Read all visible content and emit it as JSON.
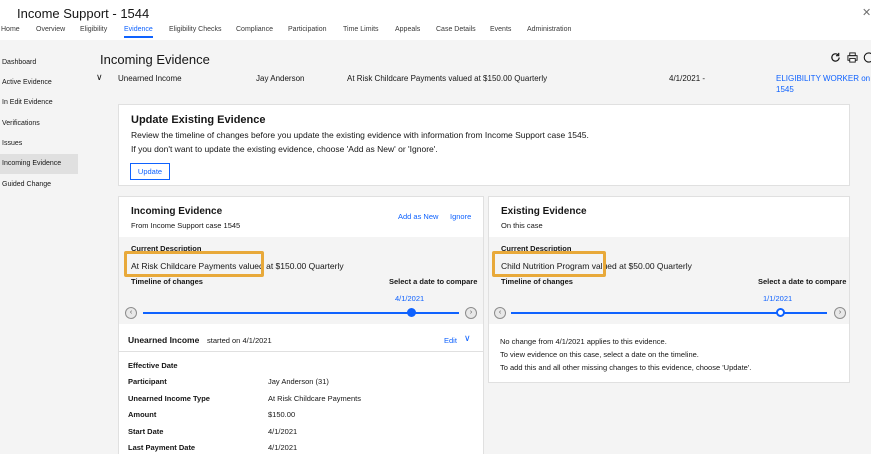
{
  "header": {
    "title": "Income Support - 1544",
    "close_glyph": "✕"
  },
  "tabs": [
    {
      "label": "Home"
    },
    {
      "label": "Overview"
    },
    {
      "label": "Eligibility"
    },
    {
      "label": "Evidence"
    },
    {
      "label": "Eligibility Checks"
    },
    {
      "label": "Compliance"
    },
    {
      "label": "Participation"
    },
    {
      "label": "Time Limits"
    },
    {
      "label": "Appeals"
    },
    {
      "label": "Case Details"
    },
    {
      "label": "Events"
    },
    {
      "label": "Administration"
    }
  ],
  "active_tab": "Evidence",
  "sidebar": {
    "items": [
      {
        "label": "Dashboard"
      },
      {
        "label": "Active Evidence"
      },
      {
        "label": "In Edit Evidence"
      },
      {
        "label": "Verifications"
      },
      {
        "label": "Issues"
      },
      {
        "label": "Incoming Evidence"
      },
      {
        "label": "Guided Change"
      }
    ],
    "active": "Incoming Evidence"
  },
  "page": {
    "title": "Incoming Evidence",
    "icons": [
      "refresh-icon",
      "print-icon",
      "help-icon"
    ]
  },
  "evidence_row": {
    "chevron": "∨",
    "type": "Unearned Income",
    "participant": "Jay Anderson",
    "description": "At Risk Childcare Payments valued at $150.00 Quarterly",
    "period": "4/1/2021 -",
    "owner_line1": "ELIGIBILITY WORKER on",
    "owner_line2": "1545"
  },
  "update_panel": {
    "title": "Update Existing Evidence",
    "line1": "Review the timeline of changes before you update the existing evidence with information from Income Support case 1545.",
    "line2": "If you don't want to update the existing evidence, choose 'Add as New' or 'Ignore'.",
    "button": "Update"
  },
  "incoming": {
    "title": "Incoming Evidence",
    "subtitle": "From Income Support case 1545",
    "add_as_new": "Add as New",
    "ignore": "Ignore",
    "current_description_label": "Current Description",
    "current_description": "At Risk Childcare Payments valued at $150.00 Quarterly",
    "timeline_label": "Timeline of changes",
    "compare_label": "Select a date to compare",
    "selected_date": "4/1/2021",
    "section_title": "Unearned Income",
    "section_started": "started on 4/1/2021",
    "edit": "Edit",
    "details": [
      {
        "label": "Effective Date",
        "value": ""
      },
      {
        "label": "Participant",
        "value": "Jay Anderson (31)"
      },
      {
        "label": "Unearned Income Type",
        "value": "At Risk Childcare Payments"
      },
      {
        "label": "Amount",
        "value": "$150.00"
      },
      {
        "label": "Start Date",
        "value": "4/1/2021"
      },
      {
        "label": "Last Payment Date",
        "value": "4/1/2021"
      }
    ],
    "colors": {
      "accent": "#0f62fe",
      "highlight": "#e8a93a"
    }
  },
  "existing": {
    "title": "Existing Evidence",
    "subtitle": "On this case",
    "current_description_label": "Current Description",
    "current_description": "Child Nutrition Program valued at $50.00 Quarterly",
    "timeline_label": "Timeline of changes",
    "compare_label": "Select a date to compare",
    "selected_date": "1/1/2021",
    "messages": [
      "No change from 4/1/2021 applies to this evidence.",
      "To view evidence on this case, select a date on the timeline.",
      "To add this and all other missing changes to this evidence, choose 'Update'."
    ]
  }
}
